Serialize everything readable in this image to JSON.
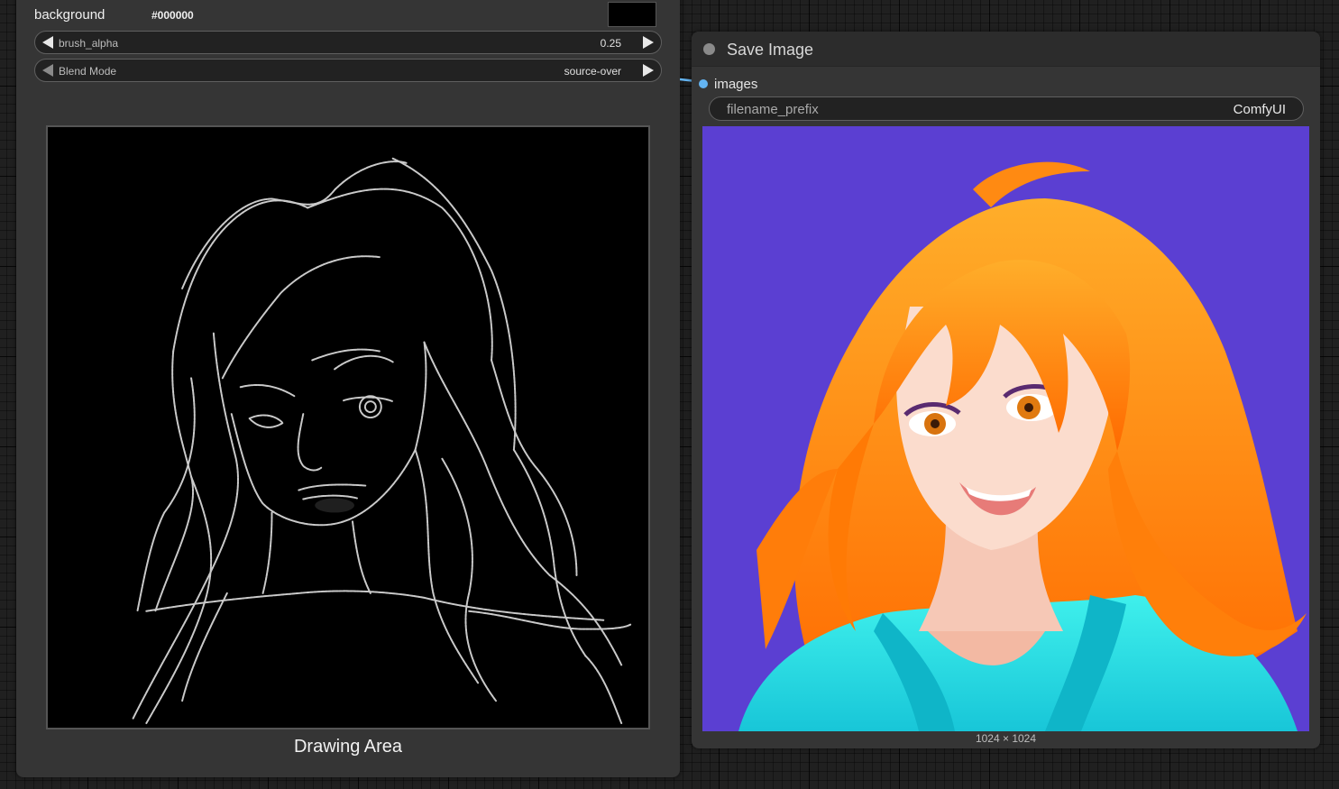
{
  "painter_node": {
    "background_label": "background",
    "background_value": "#000000",
    "background_swatch_color": "#000000",
    "brush_alpha": {
      "label": "brush_alpha",
      "value": "0.25"
    },
    "blend_mode": {
      "label": "Blend Mode",
      "value": "source-over"
    },
    "canvas_caption": "Drawing Area"
  },
  "save_node": {
    "title": "Save Image",
    "input_label": "images",
    "filename_prefix": {
      "label": "filename_prefix",
      "value": "ComfyUI"
    },
    "image_dimensions": "1024 × 1024",
    "input_dot_color": "#63b4f2",
    "preview_background_color": "#5b3fd2"
  }
}
